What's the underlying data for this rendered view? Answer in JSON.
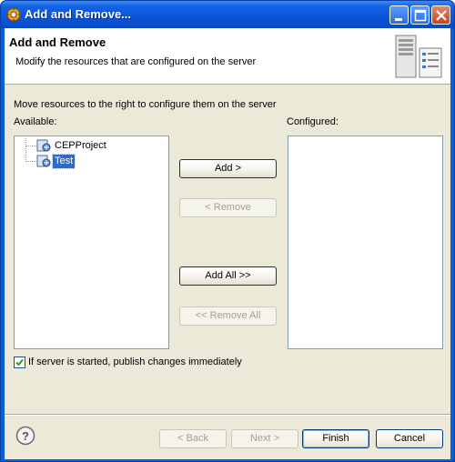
{
  "window": {
    "title": "Add and Remove..."
  },
  "header": {
    "title": "Add and Remove",
    "subtitle": "Modify the resources that are configured on the server"
  },
  "instructions": "Move resources to the right to configure them on the server",
  "available": {
    "label": "Available:",
    "items": [
      {
        "label": "CEPProject",
        "selected": false
      },
      {
        "label": "Test",
        "selected": true
      }
    ]
  },
  "configured": {
    "label": "Configured:",
    "items": []
  },
  "buttons": {
    "add": "Add >",
    "remove": "< Remove",
    "add_all": "Add All >>",
    "remove_all": "<< Remove All"
  },
  "checkbox": {
    "label": "If server is started, publish changes immediately",
    "checked": true
  },
  "footer": {
    "back": "< Back",
    "next": "Next >",
    "finish": "Finish",
    "cancel": "Cancel"
  },
  "icons": {
    "title": "eclipse-gear-icon",
    "header": "server-icon",
    "project": "web-project-icon",
    "help": "help-icon"
  },
  "colors": {
    "titlebar": "#0a55d8",
    "selection": "#316ac5",
    "dialog_bg": "#ece9d8"
  }
}
